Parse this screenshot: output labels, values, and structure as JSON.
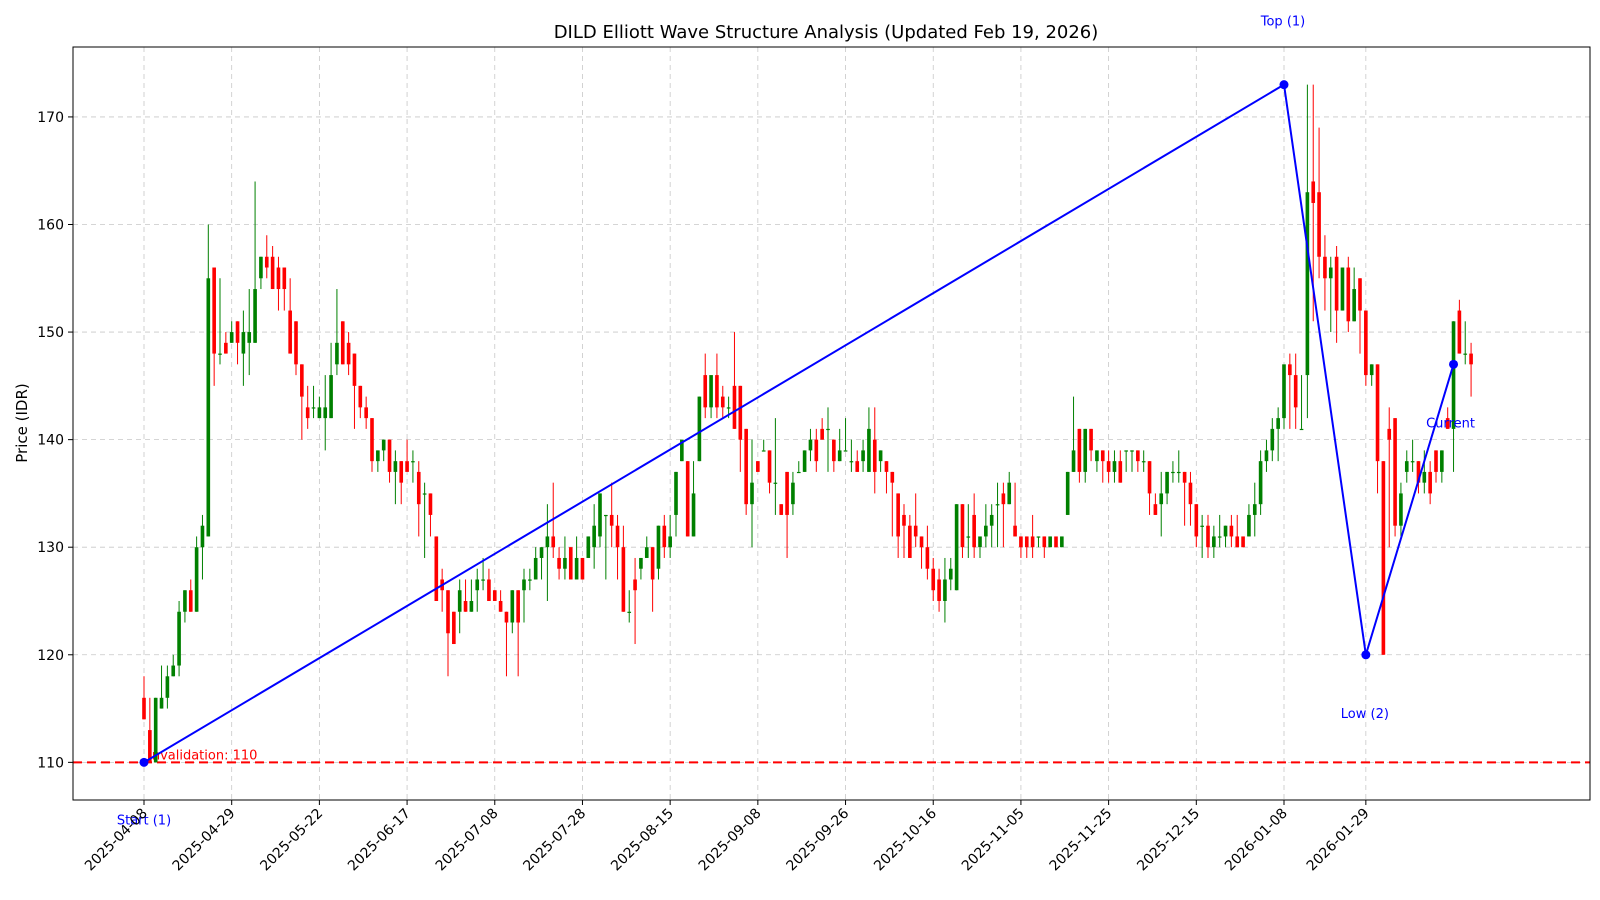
{
  "chart_data": {
    "type": "candlestick",
    "title": "DILD Elliott Wave Structure Analysis (Updated Feb 19, 2026)",
    "xlabel": "",
    "ylabel": "Price (IDR)",
    "ylim": [
      106.5,
      176.5
    ],
    "yticks": [
      110,
      120,
      130,
      140,
      150,
      160,
      170
    ],
    "grid": true,
    "colors": {
      "up": "#008000",
      "down": "#ff0000",
      "wave": "#0000ff",
      "invalidation": "#ff0000",
      "grid": "#b0b0b0"
    },
    "date_ticks": [
      {
        "label": "2025-04-08",
        "i": 0
      },
      {
        "label": "2025-04-29",
        "i": 15
      },
      {
        "label": "2025-05-22",
        "i": 30
      },
      {
        "label": "2025-06-17",
        "i": 45
      },
      {
        "label": "2025-07-08",
        "i": 60
      },
      {
        "label": "2025-07-28",
        "i": 75
      },
      {
        "label": "2025-08-15",
        "i": 90
      },
      {
        "label": "2025-09-08",
        "i": 105
      },
      {
        "label": "2025-09-26",
        "i": 120
      },
      {
        "label": "2025-10-16",
        "i": 135
      },
      {
        "label": "2025-11-05",
        "i": 150
      },
      {
        "label": "2025-11-25",
        "i": 165
      },
      {
        "label": "2025-12-15",
        "i": 180
      },
      {
        "label": "2026-01-08",
        "i": 195
      },
      {
        "label": "2026-01-29",
        "i": 209
      }
    ],
    "x_max_index": 234,
    "ohlc": [
      [
        116,
        118,
        114,
        114
      ],
      [
        113,
        116,
        110,
        110
      ],
      [
        110,
        116,
        110,
        116
      ],
      [
        115,
        119,
        115,
        116
      ],
      [
        116,
        119,
        115,
        118
      ],
      [
        118,
        120,
        118,
        119
      ],
      [
        119,
        125,
        118,
        124
      ],
      [
        124,
        126,
        123,
        126
      ],
      [
        126,
        127,
        124,
        124
      ],
      [
        124,
        131,
        124,
        130
      ],
      [
        130,
        133,
        127,
        132
      ],
      [
        131,
        160,
        131,
        155
      ],
      [
        156,
        156,
        145,
        148
      ],
      [
        148,
        155,
        147,
        148
      ],
      [
        149,
        150,
        148,
        148
      ],
      [
        149,
        151,
        149,
        150
      ],
      [
        151,
        151,
        147,
        149
      ],
      [
        148,
        152,
        145,
        150
      ],
      [
        149,
        154,
        146,
        150
      ],
      [
        149,
        164,
        149,
        154
      ],
      [
        155,
        157,
        154,
        157
      ],
      [
        157,
        159,
        155,
        156
      ],
      [
        157,
        158,
        154,
        154
      ],
      [
        156,
        157,
        152,
        154
      ],
      [
        156,
        156,
        152,
        154
      ],
      [
        152,
        155,
        148,
        148
      ],
      [
        151,
        151,
        146,
        147
      ],
      [
        147,
        147,
        140,
        144
      ],
      [
        143,
        145,
        141,
        142
      ],
      [
        143,
        145,
        142,
        143
      ],
      [
        142,
        144,
        142,
        143
      ],
      [
        142,
        146,
        139,
        143
      ],
      [
        142,
        149,
        142,
        146
      ],
      [
        147,
        154,
        146,
        149
      ],
      [
        151,
        151,
        147,
        147
      ],
      [
        149,
        150,
        146,
        147
      ],
      [
        148,
        148,
        141,
        145
      ],
      [
        145,
        145,
        142,
        143
      ],
      [
        143,
        144,
        141,
        142
      ],
      [
        142,
        142,
        137,
        138
      ],
      [
        138,
        139,
        137,
        139
      ],
      [
        139,
        140,
        138,
        140
      ],
      [
        140,
        140,
        136,
        137
      ],
      [
        137,
        139,
        134,
        138
      ],
      [
        138,
        138,
        134,
        136
      ],
      [
        138,
        140,
        138,
        137
      ],
      [
        138,
        139,
        136,
        138
      ],
      [
        137,
        138,
        131,
        134
      ],
      [
        135,
        136,
        129,
        135
      ],
      [
        135,
        135,
        131,
        133
      ],
      [
        131,
        131,
        125,
        125
      ],
      [
        127,
        128,
        124,
        126
      ],
      [
        126,
        126,
        118,
        122
      ],
      [
        124,
        124,
        121,
        121
      ],
      [
        124,
        127,
        122,
        126
      ],
      [
        125,
        127,
        124,
        124
      ],
      [
        124,
        127,
        124,
        125
      ],
      [
        126,
        128,
        124,
        127
      ],
      [
        127,
        129,
        126,
        127
      ],
      [
        127,
        128,
        125,
        125
      ],
      [
        126,
        126,
        125,
        125
      ],
      [
        125,
        126,
        124,
        124
      ],
      [
        124,
        124,
        118,
        123
      ],
      [
        123,
        126,
        122,
        126
      ],
      [
        126,
        126,
        118,
        123
      ],
      [
        126,
        128,
        123,
        127
      ],
      [
        127,
        128,
        126,
        127
      ],
      [
        127,
        130,
        127,
        129
      ],
      [
        129,
        130,
        127,
        130
      ],
      [
        130,
        134,
        125,
        131
      ],
      [
        131,
        136,
        129,
        130
      ],
      [
        129,
        130,
        127,
        128
      ],
      [
        128,
        131,
        127,
        129
      ],
      [
        130,
        130,
        127,
        127
      ],
      [
        127,
        131,
        127,
        129
      ],
      [
        129,
        129,
        127,
        127
      ],
      [
        129,
        131,
        129,
        131
      ],
      [
        130,
        134,
        128,
        132
      ],
      [
        131,
        135,
        130,
        135
      ],
      [
        133,
        133,
        127,
        133
      ],
      [
        133,
        136,
        130,
        132
      ],
      [
        132,
        133,
        127,
        130
      ],
      [
        130,
        132,
        124,
        124
      ],
      [
        124,
        126,
        123,
        124
      ],
      [
        127,
        129,
        121,
        126
      ],
      [
        128,
        129,
        127,
        129
      ],
      [
        129,
        131,
        129,
        130
      ],
      [
        130,
        130,
        124,
        127
      ],
      [
        128,
        132,
        127,
        132
      ],
      [
        132,
        133,
        129,
        130
      ],
      [
        130,
        133,
        129,
        131
      ],
      [
        133,
        137,
        131,
        137
      ],
      [
        138,
        140,
        138,
        140
      ],
      [
        138,
        138,
        131,
        131
      ],
      [
        131,
        138,
        131,
        135
      ],
      [
        138,
        144,
        138,
        144
      ],
      [
        146,
        148,
        142,
        143
      ],
      [
        143,
        144,
        142,
        146
      ],
      [
        146,
        148,
        142,
        143
      ],
      [
        144,
        145,
        142,
        143
      ],
      [
        143,
        144,
        142,
        143
      ],
      [
        145,
        150,
        141,
        141
      ],
      [
        145,
        145,
        137,
        140
      ],
      [
        141,
        141,
        133,
        134
      ],
      [
        134,
        140,
        130,
        136
      ],
      [
        138,
        138,
        137,
        137
      ],
      [
        139,
        140,
        139,
        139
      ],
      [
        139,
        139,
        135,
        136
      ],
      [
        136,
        142,
        133,
        136
      ],
      [
        134,
        134,
        133,
        133
      ],
      [
        137,
        137,
        129,
        133
      ],
      [
        134,
        137,
        133,
        136
      ],
      [
        137,
        138,
        137,
        137
      ],
      [
        137,
        139,
        137,
        139
      ],
      [
        139,
        141,
        138,
        140
      ],
      [
        140,
        141,
        137,
        138
      ],
      [
        141,
        142,
        140,
        140
      ],
      [
        141,
        143,
        137,
        141
      ],
      [
        140,
        140,
        137,
        138
      ],
      [
        138,
        141,
        138,
        139
      ],
      [
        139,
        142,
        139,
        139
      ],
      [
        138,
        140,
        137,
        138
      ],
      [
        138,
        139,
        137,
        137
      ],
      [
        138,
        140,
        137,
        139
      ],
      [
        137,
        143,
        137,
        141
      ],
      [
        140,
        143,
        135,
        137
      ],
      [
        138,
        139,
        137,
        139
      ],
      [
        138,
        138,
        135,
        137
      ],
      [
        137,
        137,
        131,
        136
      ],
      [
        135,
        135,
        129,
        131
      ],
      [
        133,
        134,
        129,
        132
      ],
      [
        132,
        133,
        129,
        129
      ],
      [
        132,
        135,
        130,
        131
      ],
      [
        131,
        131,
        128,
        130
      ],
      [
        130,
        132,
        127,
        128
      ],
      [
        128,
        129,
        125,
        126
      ],
      [
        127,
        128,
        124,
        125
      ],
      [
        125,
        129,
        123,
        127
      ],
      [
        127,
        129,
        126,
        128
      ],
      [
        126,
        134,
        126,
        134
      ],
      [
        134,
        134,
        129,
        130
      ],
      [
        131,
        134,
        129,
        131
      ],
      [
        133,
        135,
        129,
        130
      ],
      [
        130,
        130,
        129,
        131
      ],
      [
        131,
        134,
        130,
        132
      ],
      [
        132,
        134,
        130,
        133
      ],
      [
        134,
        136,
        130,
        134
      ],
      [
        135,
        136,
        130,
        134
      ],
      [
        134,
        137,
        134,
        136
      ],
      [
        132,
        136,
        131,
        131
      ],
      [
        131,
        131,
        129,
        130
      ],
      [
        131,
        131,
        129,
        130
      ],
      [
        131,
        133,
        129,
        130
      ],
      [
        131,
        131,
        130,
        131
      ],
      [
        131,
        131,
        129,
        130
      ],
      [
        130,
        131,
        130,
        131
      ],
      [
        131,
        131,
        130,
        130
      ],
      [
        130,
        131,
        130,
        131
      ],
      [
        133,
        137,
        133,
        137
      ],
      [
        137,
        144,
        137,
        139
      ],
      [
        141,
        141,
        136,
        137
      ],
      [
        137,
        141,
        136,
        141
      ],
      [
        141,
        141,
        138,
        139
      ],
      [
        138,
        139,
        137,
        139
      ],
      [
        139,
        139,
        136,
        138
      ],
      [
        138,
        139,
        136,
        137
      ],
      [
        137,
        139,
        136,
        138
      ],
      [
        138,
        139,
        136,
        136
      ],
      [
        139,
        139,
        137,
        139
      ],
      [
        139,
        139,
        137,
        139
      ],
      [
        139,
        139,
        137,
        138
      ],
      [
        138,
        139,
        137,
        138
      ],
      [
        138,
        138,
        133,
        135
      ],
      [
        134,
        135,
        133,
        133
      ],
      [
        134,
        137,
        131,
        135
      ],
      [
        135,
        137,
        134,
        137
      ],
      [
        137,
        138,
        136,
        137
      ],
      [
        137,
        139,
        136,
        137
      ],
      [
        137,
        137,
        132,
        136
      ],
      [
        136,
        137,
        132,
        134
      ],
      [
        134,
        134,
        130,
        131
      ],
      [
        132,
        133,
        129,
        132
      ],
      [
        132,
        133,
        129,
        130
      ],
      [
        130,
        132,
        129,
        131
      ],
      [
        131,
        133,
        130,
        131
      ],
      [
        131,
        132,
        130,
        132
      ],
      [
        132,
        133,
        130,
        131
      ],
      [
        131,
        133,
        130,
        130
      ],
      [
        131,
        131,
        130,
        130
      ],
      [
        131,
        134,
        131,
        133
      ],
      [
        133,
        136,
        131,
        134
      ],
      [
        134,
        139,
        133,
        138
      ],
      [
        138,
        140,
        137,
        139
      ],
      [
        139,
        142,
        138,
        141
      ],
      [
        141,
        143,
        138,
        142
      ],
      [
        142,
        144,
        141,
        147
      ],
      [
        147,
        148,
        141,
        146
      ],
      [
        146,
        148,
        141,
        143
      ],
      [
        141,
        146,
        141,
        141
      ],
      [
        146,
        173,
        142,
        163
      ],
      [
        164,
        173,
        151,
        162
      ],
      [
        163,
        169,
        155,
        157
      ],
      [
        157,
        159,
        152,
        155
      ],
      [
        155,
        157,
        150,
        156
      ],
      [
        157,
        158,
        149,
        152
      ],
      [
        152,
        156,
        152,
        156
      ],
      [
        156,
        157,
        150,
        151
      ],
      [
        151,
        156,
        151,
        154
      ],
      [
        155,
        155,
        148,
        152
      ],
      [
        152,
        152,
        145,
        146
      ],
      [
        146,
        147,
        145,
        147
      ],
      [
        147,
        147,
        135,
        138
      ],
      [
        138,
        138,
        120,
        120
      ],
      [
        141,
        143,
        130,
        140
      ],
      [
        142,
        142,
        131,
        132
      ],
      [
        132,
        136,
        131,
        135
      ],
      [
        137,
        139,
        136,
        138
      ],
      [
        138,
        140,
        137,
        138
      ],
      [
        138,
        138,
        135,
        136
      ],
      [
        136,
        139,
        135,
        137
      ],
      [
        137,
        138,
        134,
        135
      ],
      [
        139,
        139,
        136,
        137
      ],
      [
        137,
        139,
        136,
        139
      ],
      [
        142,
        143,
        141,
        141
      ],
      [
        141,
        151,
        137,
        151
      ],
      [
        152,
        153,
        148,
        148
      ],
      [
        148,
        151,
        147,
        148
      ],
      [
        148,
        149,
        144,
        147
      ]
    ],
    "wave_points": [
      {
        "i": 0,
        "y": 110,
        "label": "Start (1)"
      },
      {
        "i": 195,
        "y": 173,
        "label": "Top (1)"
      },
      {
        "i": 209,
        "y": 120,
        "label": "Low (2)"
      },
      {
        "i": 224,
        "y": 147,
        "label": "Current"
      }
    ],
    "invalidation": {
      "y": 110,
      "label": "Invalidation: 110"
    }
  }
}
